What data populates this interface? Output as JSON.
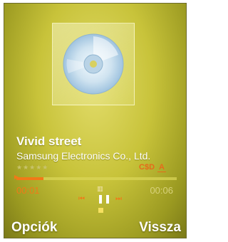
{
  "track": {
    "title": "Vivid street",
    "artist": "Samsung Electronics Co., Ltd.",
    "rating_stars": "★★★★★",
    "rating_value": 0
  },
  "playback": {
    "current_time": "00:01",
    "total_time": "00:06",
    "progress_fraction": 0.167
  },
  "mode_icons": {
    "shuffle": "C$D",
    "repeat": "A"
  },
  "softkeys": {
    "left": "Opciók",
    "right": "Vissza"
  },
  "colors": {
    "accent": "#f07a18",
    "background": "#c8c33a",
    "text": "#ffffff"
  },
  "icons": {
    "album_art": "cd-icon",
    "prev": "skip-previous-icon",
    "pause": "pause-icon",
    "next": "skip-next-icon",
    "up": "volume-up-icon",
    "stop": "stop-icon"
  }
}
